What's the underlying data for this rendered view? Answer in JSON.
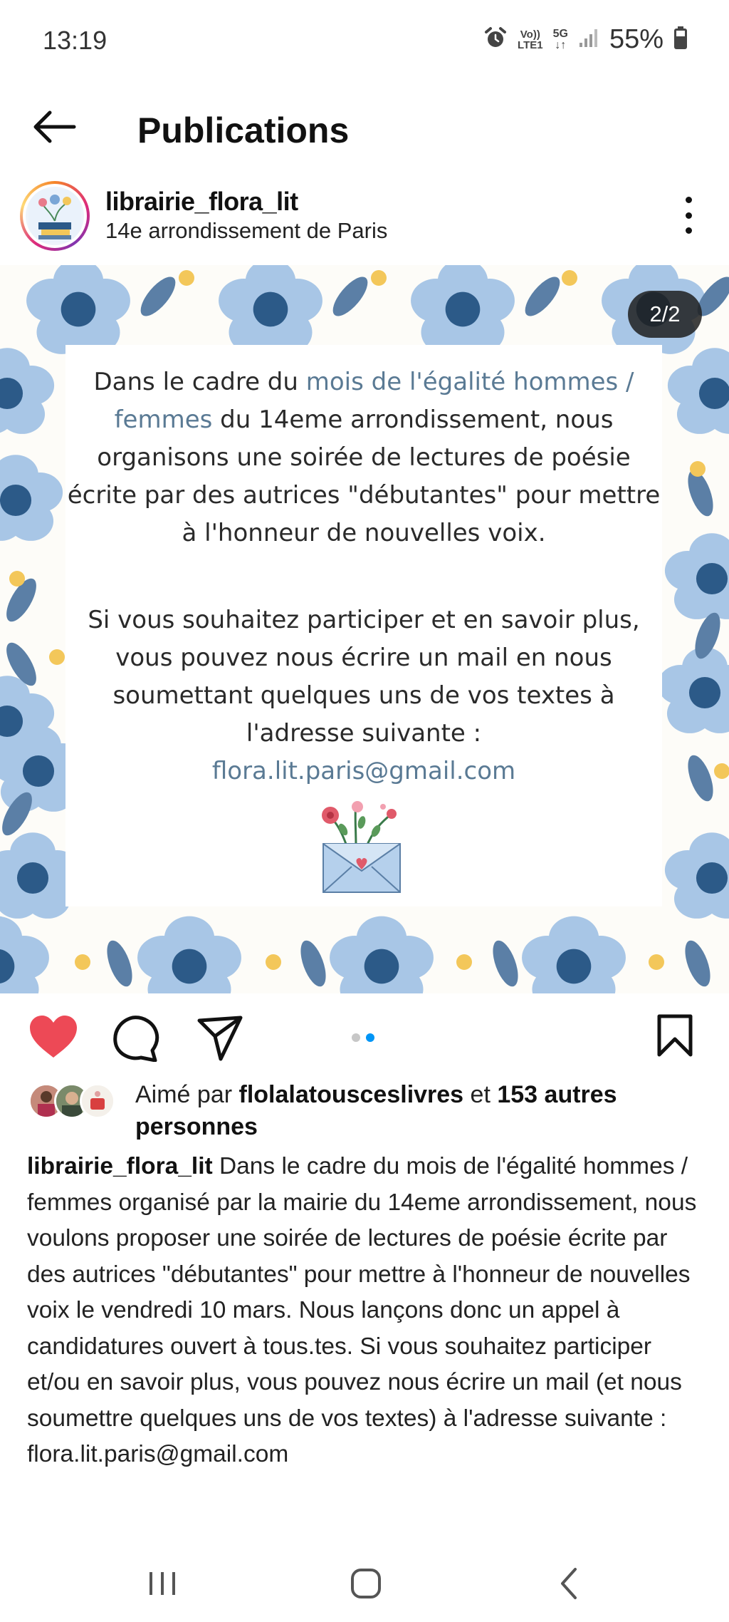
{
  "status_bar": {
    "time": "13:19",
    "volte_top": "Vo))",
    "volte_bottom": "LTE1",
    "network": "5G",
    "battery": "55%"
  },
  "header": {
    "title": "Publications",
    "back_icon": "arrow-left-icon"
  },
  "post": {
    "username": "librairie_flora_lit",
    "location": "14e arrondissement de Paris",
    "page_counter": "2/2",
    "image_text": {
      "p1_before": "Dans le cadre du ",
      "p1_highlight": "mois de l'égalité hommes / femmes",
      "p1_after": " du 14eme arrondissement, nous organisons une soirée de lectures de poésie écrite par des autrices \"débutantes\" pour mettre à l'honneur de nouvelles voix.",
      "p2": "Si vous souhaitez participer et en savoir plus, vous pouvez nous écrire un mail en nous soumettant quelques uns de vos textes à l'adresse suivante :",
      "email": "flora.lit.paris@gmail.com"
    },
    "carousel": {
      "count": 2,
      "active": 2
    },
    "likes": {
      "prefix": "Aimé par ",
      "user": "flolalatousceslivres",
      "middle": " et ",
      "count_text": "153 autres personnes"
    },
    "caption": {
      "username": "librairie_flora_lit",
      "text": "Dans le cadre du mois de l'égalité hommes / femmes organisé par la mairie du 14eme arrondissement, nous voulons proposer une soirée de lectures de poésie écrite par des autrices \"débutantes\" pour mettre à l'honneur de nouvelles voix le vendredi 10 mars. Nous lançons donc un appel à candidatures ouvert à tous.tes. Si vous souhaitez participer et/ou en savoir plus, vous pouvez nous écrire un mail (et nous soumettre quelques uns de vos textes) à l'adresse suivante : flora.lit.paris@gmail.com"
    }
  },
  "colors": {
    "like_red": "#ed4956",
    "pattern_light_blue": "#a8c6e6",
    "pattern_dark_blue": "#2c5a88",
    "pattern_leaf": "#5b7fa6",
    "pattern_yellow": "#f3c75a",
    "carousel_active": "#0095f6",
    "carousel_inactive": "#c7c7c7"
  }
}
